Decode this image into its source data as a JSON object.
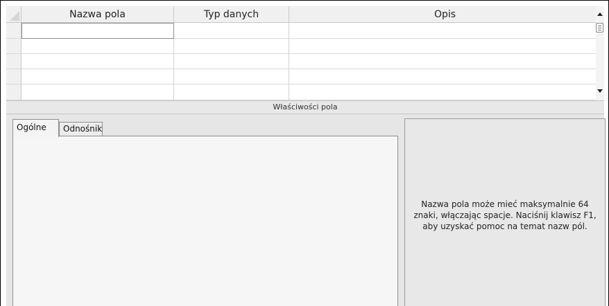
{
  "grid": {
    "columns": [
      {
        "label": "Nazwa pola"
      },
      {
        "label": "Typ danych"
      },
      {
        "label": "Opis"
      }
    ],
    "rows": [
      {
        "nazwa": "",
        "typ": "",
        "opis": ""
      },
      {
        "nazwa": "",
        "typ": "",
        "opis": ""
      },
      {
        "nazwa": "",
        "typ": "",
        "opis": ""
      },
      {
        "nazwa": "",
        "typ": "",
        "opis": ""
      },
      {
        "nazwa": "",
        "typ": "",
        "opis": ""
      }
    ]
  },
  "properties": {
    "title": "Właściwości pola",
    "tabs": [
      {
        "label": "Ogólne",
        "active": true
      },
      {
        "label": "Odnośnik",
        "active": false
      }
    ],
    "help_text": "Nazwa pola może mieć maksymalnie 64 znaki, włączając spacje. Naciśnij klawisz F1, aby uzyskać pomoc na temat nazw pól."
  }
}
